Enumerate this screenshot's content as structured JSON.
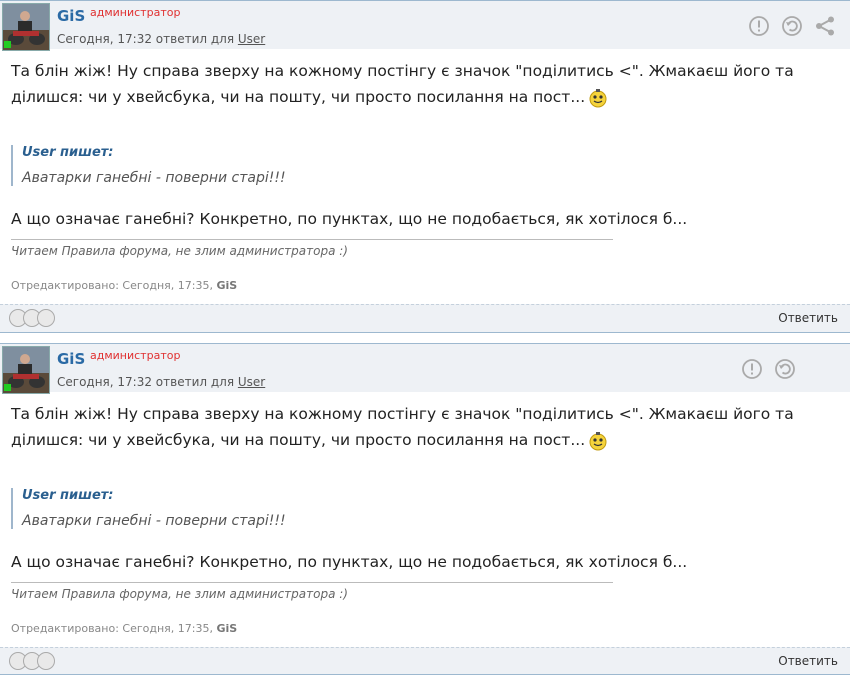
{
  "posts": [
    {
      "author": "GiS",
      "role": "администратор",
      "meta_prefix": "Сегодня, 17:32 ответил для",
      "reply_to": "User",
      "line1": "Та блін жіж! Ну справа зверху на кожному постінгу є значок \"поділитись <\". Жмакаєш його та",
      "line2": "ділишся: чи у хвейсбука, чи на пошту, чи просто посилання на пост...",
      "quote_author": "User пишет:",
      "quote_text": "Аватарки ганебні - поверни старі!!!",
      "line3": "А що означає ганебні? Конкретно, по пунктах, що не подобається, як хотілося б...",
      "signature": "Читаем Правила форума, не злим администратора :)",
      "edited_prefix": "Отредактировано: Сегодня, 17:35,",
      "edited_by": "GiS",
      "reply_label": "Ответить",
      "header_icons": [
        "report-icon",
        "undo-icon",
        "share-icon"
      ]
    },
    {
      "author": "GiS",
      "role": "администратор",
      "meta_prefix": "Сегодня, 17:32 ответил для",
      "reply_to": "User",
      "line1": "Та блін жіж! Ну справа зверху на кожному постінгу є значок \"поділитись <\". Жмакаєш його та",
      "line2": "ділишся: чи у хвейсбука, чи на пошту, чи просто посилання на пост...",
      "quote_author": "User пишет:",
      "quote_text": "Аватарки ганебні - поверни старі!!!",
      "line3": "А що означає ганебні? Конкретно, по пунктах, що не подобається, як хотілося б...",
      "signature": "Читаем Правила форума, не злим администратора :)",
      "edited_prefix": "Отредактировано: Сегодня, 17:35,",
      "edited_by": "GiS",
      "reply_label": "Ответить",
      "header_icons": [
        "report-icon",
        "undo-icon"
      ]
    }
  ],
  "colors": {
    "header_bg": "#eef1f5",
    "author": "#2a6aa5",
    "role": "#e03030",
    "quote_author": "#2a5f8f"
  }
}
